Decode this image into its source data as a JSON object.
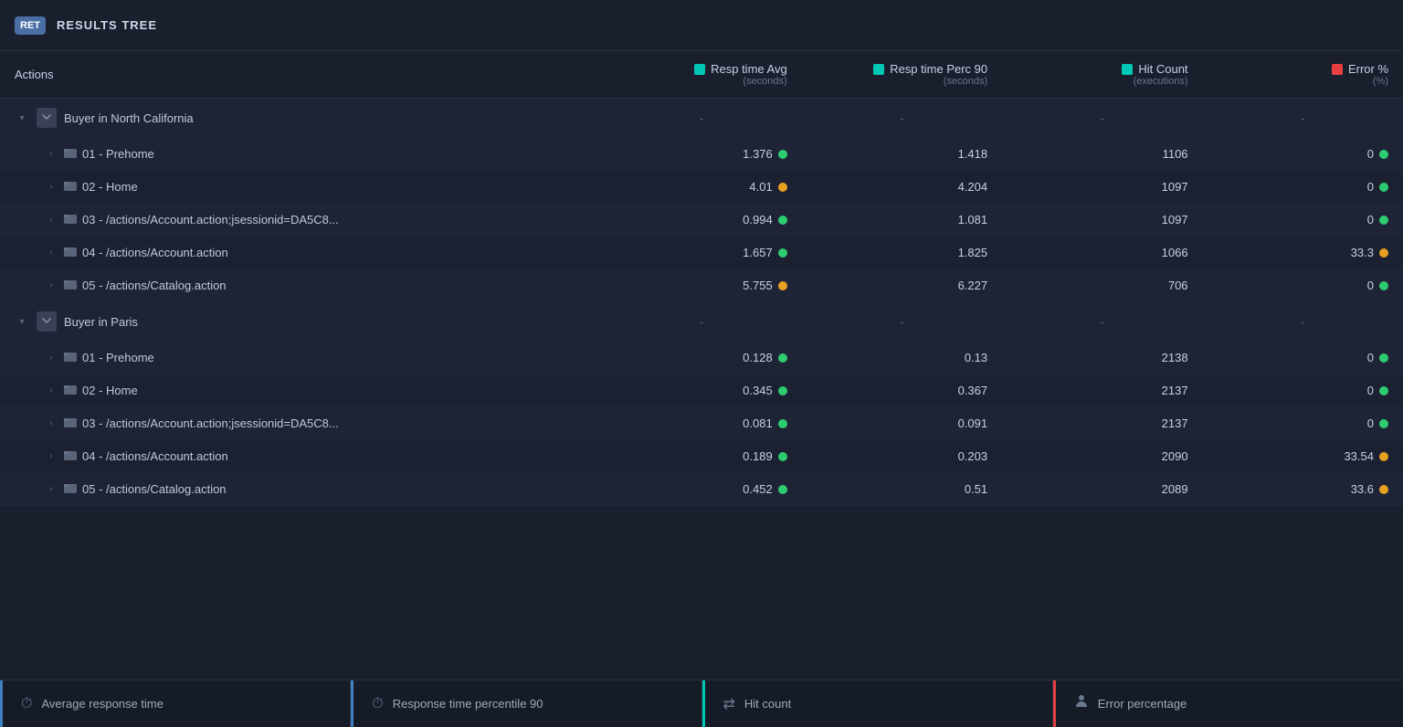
{
  "app": {
    "logo": "RET",
    "title": "RESULTS TREE"
  },
  "table": {
    "columns": [
      {
        "key": "actions",
        "label": "Actions",
        "sub": "",
        "color": null
      },
      {
        "key": "resp_avg",
        "label": "Resp time Avg",
        "sub": "(seconds)",
        "color": "teal"
      },
      {
        "key": "resp_p90",
        "label": "Resp time Perc 90",
        "sub": "(seconds)",
        "color": "teal"
      },
      {
        "key": "hit_count",
        "label": "Hit Count",
        "sub": "(executions)",
        "color": "teal"
      },
      {
        "key": "error_pct",
        "label": "Error %",
        "sub": "(%)",
        "color": "red"
      }
    ],
    "groups": [
      {
        "name": "Buyer in North California",
        "icon": "N",
        "resp_avg": "-",
        "resp_p90": "-",
        "hit_count": "-",
        "error_pct": "-",
        "items": [
          {
            "name": "01 - Prehome",
            "resp_avg": "1.376",
            "resp_avg_status": "green",
            "resp_p90": "1.418",
            "hit_count": "1106",
            "error_pct": "0",
            "error_status": "green"
          },
          {
            "name": "02 - Home",
            "resp_avg": "4.01",
            "resp_avg_status": "orange",
            "resp_p90": "4.204",
            "hit_count": "1097",
            "error_pct": "0",
            "error_status": "green"
          },
          {
            "name": "03 - /actions/Account.action;jsessionid=DA5C8...",
            "resp_avg": "0.994",
            "resp_avg_status": "green",
            "resp_p90": "1.081",
            "hit_count": "1097",
            "error_pct": "0",
            "error_status": "green"
          },
          {
            "name": "04 - /actions/Account.action",
            "resp_avg": "1.657",
            "resp_avg_status": "green",
            "resp_p90": "1.825",
            "hit_count": "1066",
            "error_pct": "33.3",
            "error_status": "orange"
          },
          {
            "name": "05 - /actions/Catalog.action",
            "resp_avg": "5.755",
            "resp_avg_status": "orange",
            "resp_p90": "6.227",
            "hit_count": "706",
            "error_pct": "0",
            "error_status": "green"
          }
        ]
      },
      {
        "name": "Buyer in Paris",
        "icon": "P",
        "resp_avg": "-",
        "resp_p90": "-",
        "hit_count": "-",
        "error_pct": "-",
        "items": [
          {
            "name": "01 - Prehome",
            "resp_avg": "0.128",
            "resp_avg_status": "green",
            "resp_p90": "0.13",
            "hit_count": "2138",
            "error_pct": "0",
            "error_status": "green"
          },
          {
            "name": "02 - Home",
            "resp_avg": "0.345",
            "resp_avg_status": "green",
            "resp_p90": "0.367",
            "hit_count": "2137",
            "error_pct": "0",
            "error_status": "green"
          },
          {
            "name": "03 - /actions/Account.action;jsessionid=DA5C8...",
            "resp_avg": "0.081",
            "resp_avg_status": "green",
            "resp_p90": "0.091",
            "hit_count": "2137",
            "error_pct": "0",
            "error_status": "green"
          },
          {
            "name": "04 - /actions/Account.action",
            "resp_avg": "0.189",
            "resp_avg_status": "green",
            "resp_p90": "0.203",
            "hit_count": "2090",
            "error_pct": "33.54",
            "error_status": "orange"
          },
          {
            "name": "05 - /actions/Catalog.action",
            "resp_avg": "0.452",
            "resp_avg_status": "green",
            "resp_p90": "0.51",
            "hit_count": "2089",
            "error_pct": "33.6",
            "error_status": "orange"
          }
        ]
      }
    ]
  },
  "footer": {
    "items": [
      {
        "icon": "⏱",
        "label": "Average response time"
      },
      {
        "icon": "⏱",
        "label": "Response time percentile 90"
      },
      {
        "icon": "⇄",
        "label": "Hit count"
      },
      {
        "icon": "👤",
        "label": "Error percentage"
      }
    ]
  }
}
